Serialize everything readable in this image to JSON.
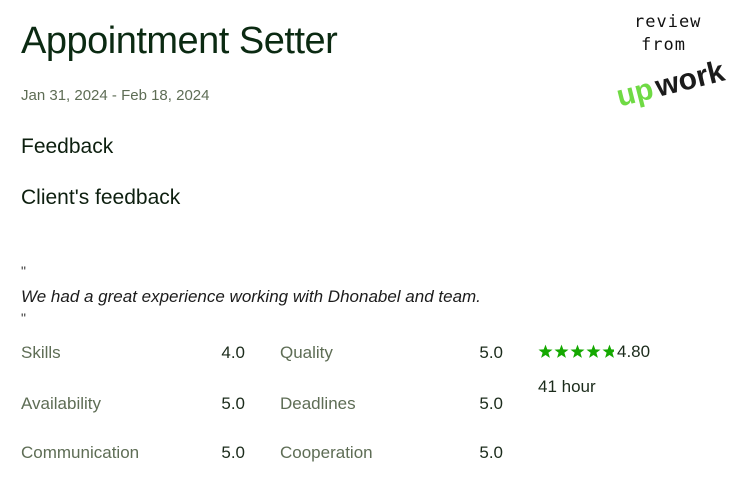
{
  "job": {
    "title": "Appointment Setter",
    "date_range": "Jan 31, 2024 - Feb 18, 2024"
  },
  "sections": {
    "feedback_heading": "Feedback",
    "client_feedback_heading": "Client's feedback"
  },
  "review": {
    "open_quote": "\"",
    "text": "We had a great experience working with Dhonabel and team.",
    "close_quote": "\""
  },
  "scores": {
    "left": [
      {
        "label": "Skills",
        "value": "4.0"
      },
      {
        "label": "Availability",
        "value": "5.0"
      },
      {
        "label": "Communication",
        "value": "5.0"
      }
    ],
    "right": [
      {
        "label": "Quality",
        "value": "5.0"
      },
      {
        "label": "Deadlines",
        "value": "5.0"
      },
      {
        "label": "Cooperation",
        "value": "5.0"
      }
    ]
  },
  "summary": {
    "rating": "4.80",
    "rating_value": 4.8,
    "rating_max": 5,
    "hours": "41 hour",
    "star_color": "#14a800"
  },
  "badge": {
    "line1": "review",
    "line2": "from",
    "logo_text": "upwork",
    "logo_color_up": "#6fda44",
    "logo_color_work": "#1b1b1b",
    "icon": "upwork-logo-icon"
  }
}
